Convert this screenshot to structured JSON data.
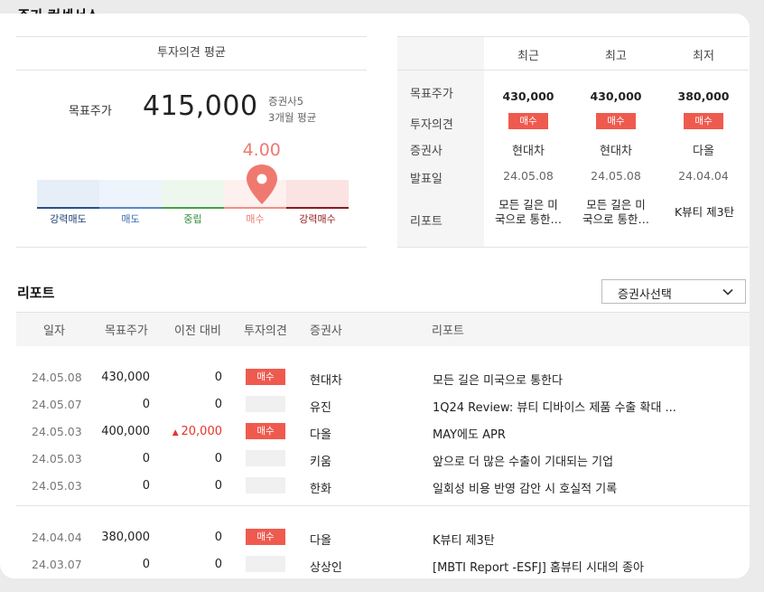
{
  "section_title": "주가 컨센서스",
  "summary": {
    "opinion_header": "투자의견 평균",
    "target_label": "목표주가",
    "target_value": "415,000",
    "sub_count": "증권사5",
    "sub_period": "3개월 평균",
    "score": "4.00",
    "score_position": 0.75,
    "scale_labels": [
      "강력매도",
      "매도",
      "중립",
      "매수",
      "강력매수"
    ],
    "scale_colors": {
      "bg": [
        "#e6eef8",
        "#eef4fc",
        "#edf7ee",
        "#fdf0ef",
        "#fbe3e3"
      ],
      "line": [
        "#2a4f8a",
        "#5a86c8",
        "#43a048",
        "#f08f86",
        "#8a1b1b"
      ],
      "text": [
        "#1f3f73",
        "#3a6bb0",
        "#2e8b3b",
        "#ec7b73",
        "#8f1c1c"
      ]
    },
    "pin_color": "#f0796f"
  },
  "stats": {
    "columns": [
      "최근",
      "최고",
      "최저"
    ],
    "rows": {
      "labels": [
        "목표주가",
        "투자의견",
        "증권사",
        "발표일",
        "리포트"
      ],
      "target": [
        "430,000",
        "430,000",
        "380,000"
      ],
      "opinion": [
        "매수",
        "매수",
        "매수"
      ],
      "broker": [
        "현대차",
        "현대차",
        "다올"
      ],
      "date": [
        "24.05.08",
        "24.05.08",
        "24.04.04"
      ],
      "report_line1": [
        "모든 길은 미",
        "모든 길은 미",
        "K뷰티 제3탄"
      ],
      "report_line2": [
        "국으로 통한…",
        "국으로 통한…",
        ""
      ]
    }
  },
  "reports": {
    "title": "리포트",
    "select_label": "증권사선택",
    "headers": [
      "일자",
      "목표주가",
      "이전 대비",
      "투자의견",
      "증권사",
      "리포트"
    ],
    "rows": [
      {
        "date": "24.05.08",
        "target": "430,000",
        "diff": "0",
        "diff_up": false,
        "opinion": "매수",
        "broker": "현대차",
        "title": "모든 길은 미국으로 통한다"
      },
      {
        "date": "24.05.07",
        "target": "0",
        "diff": "0",
        "diff_up": false,
        "opinion": "",
        "broker": "유진",
        "title": "1Q24 Review: 뷰티 디바이스 제품 수출 확대 ..."
      },
      {
        "date": "24.05.03",
        "target": "400,000",
        "diff": "20,000",
        "diff_up": true,
        "opinion": "매수",
        "broker": "다올",
        "title": "MAY에도 APR"
      },
      {
        "date": "24.05.03",
        "target": "0",
        "diff": "0",
        "diff_up": false,
        "opinion": "",
        "broker": "키움",
        "title": "앞으로 더 많은 수출이 기대되는 기업"
      },
      {
        "date": "24.05.03",
        "target": "0",
        "diff": "0",
        "diff_up": false,
        "opinion": "",
        "broker": "한화",
        "title": "일회성 비용 반영 감안 시 호실적 기록"
      },
      {
        "date": "24.04.04",
        "target": "380,000",
        "diff": "0",
        "diff_up": false,
        "opinion": "매수",
        "broker": "다올",
        "title": "K뷰티 제3탄"
      },
      {
        "date": "24.03.07",
        "target": "0",
        "diff": "0",
        "diff_up": false,
        "opinion": "",
        "broker": "상상인",
        "title": "[MBTI Report -ESFJ] 홈뷰티 시대의 종아"
      }
    ]
  }
}
